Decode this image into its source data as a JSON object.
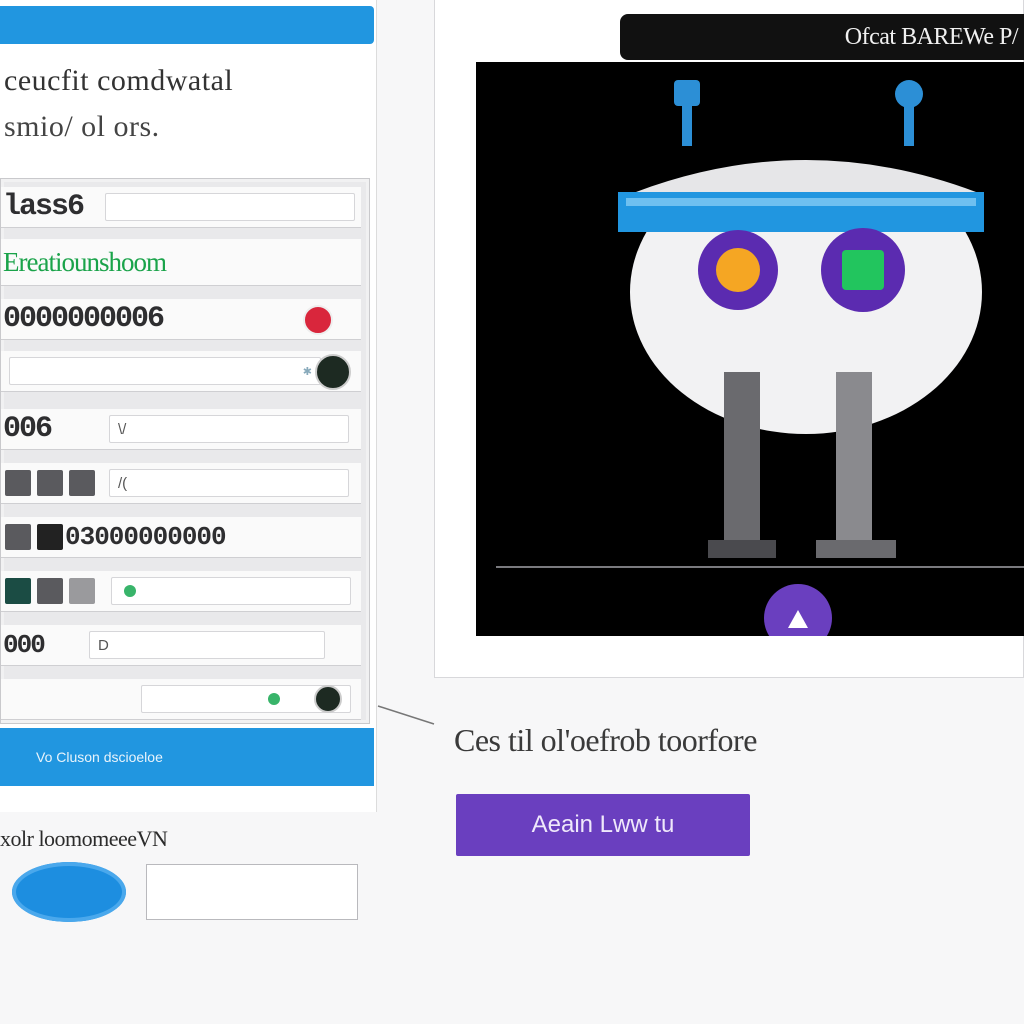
{
  "left": {
    "heading_line1": "ceucfit comdwatal",
    "heading_line2": "smio/ ol ors.",
    "rows": [
      {
        "label": "lass6"
      },
      {
        "label": "Ereatiounshoom"
      },
      {
        "label": "0000000006"
      },
      {
        "label": ""
      },
      {
        "label": "006",
        "value": "\\/"
      },
      {
        "label": "",
        "value": "/("
      },
      {
        "label": "03000000000"
      },
      {
        "label": ""
      },
      {
        "label": "000",
        "value": "D"
      },
      {
        "label": ""
      }
    ],
    "bottom_bar_text": "Vo  Cluson dscioeloe",
    "sub_label": "xolr loomomeeeVN"
  },
  "right": {
    "title": "Ofcat  BAREWe P/",
    "caption": "Ces til ol'oefrob toorfore",
    "action_label": "Aeain Lww tu"
  },
  "colors": {
    "accent_blue": "#2196e0",
    "accent_purple": "#6a3fbf",
    "label_green": "#1aa34a"
  }
}
